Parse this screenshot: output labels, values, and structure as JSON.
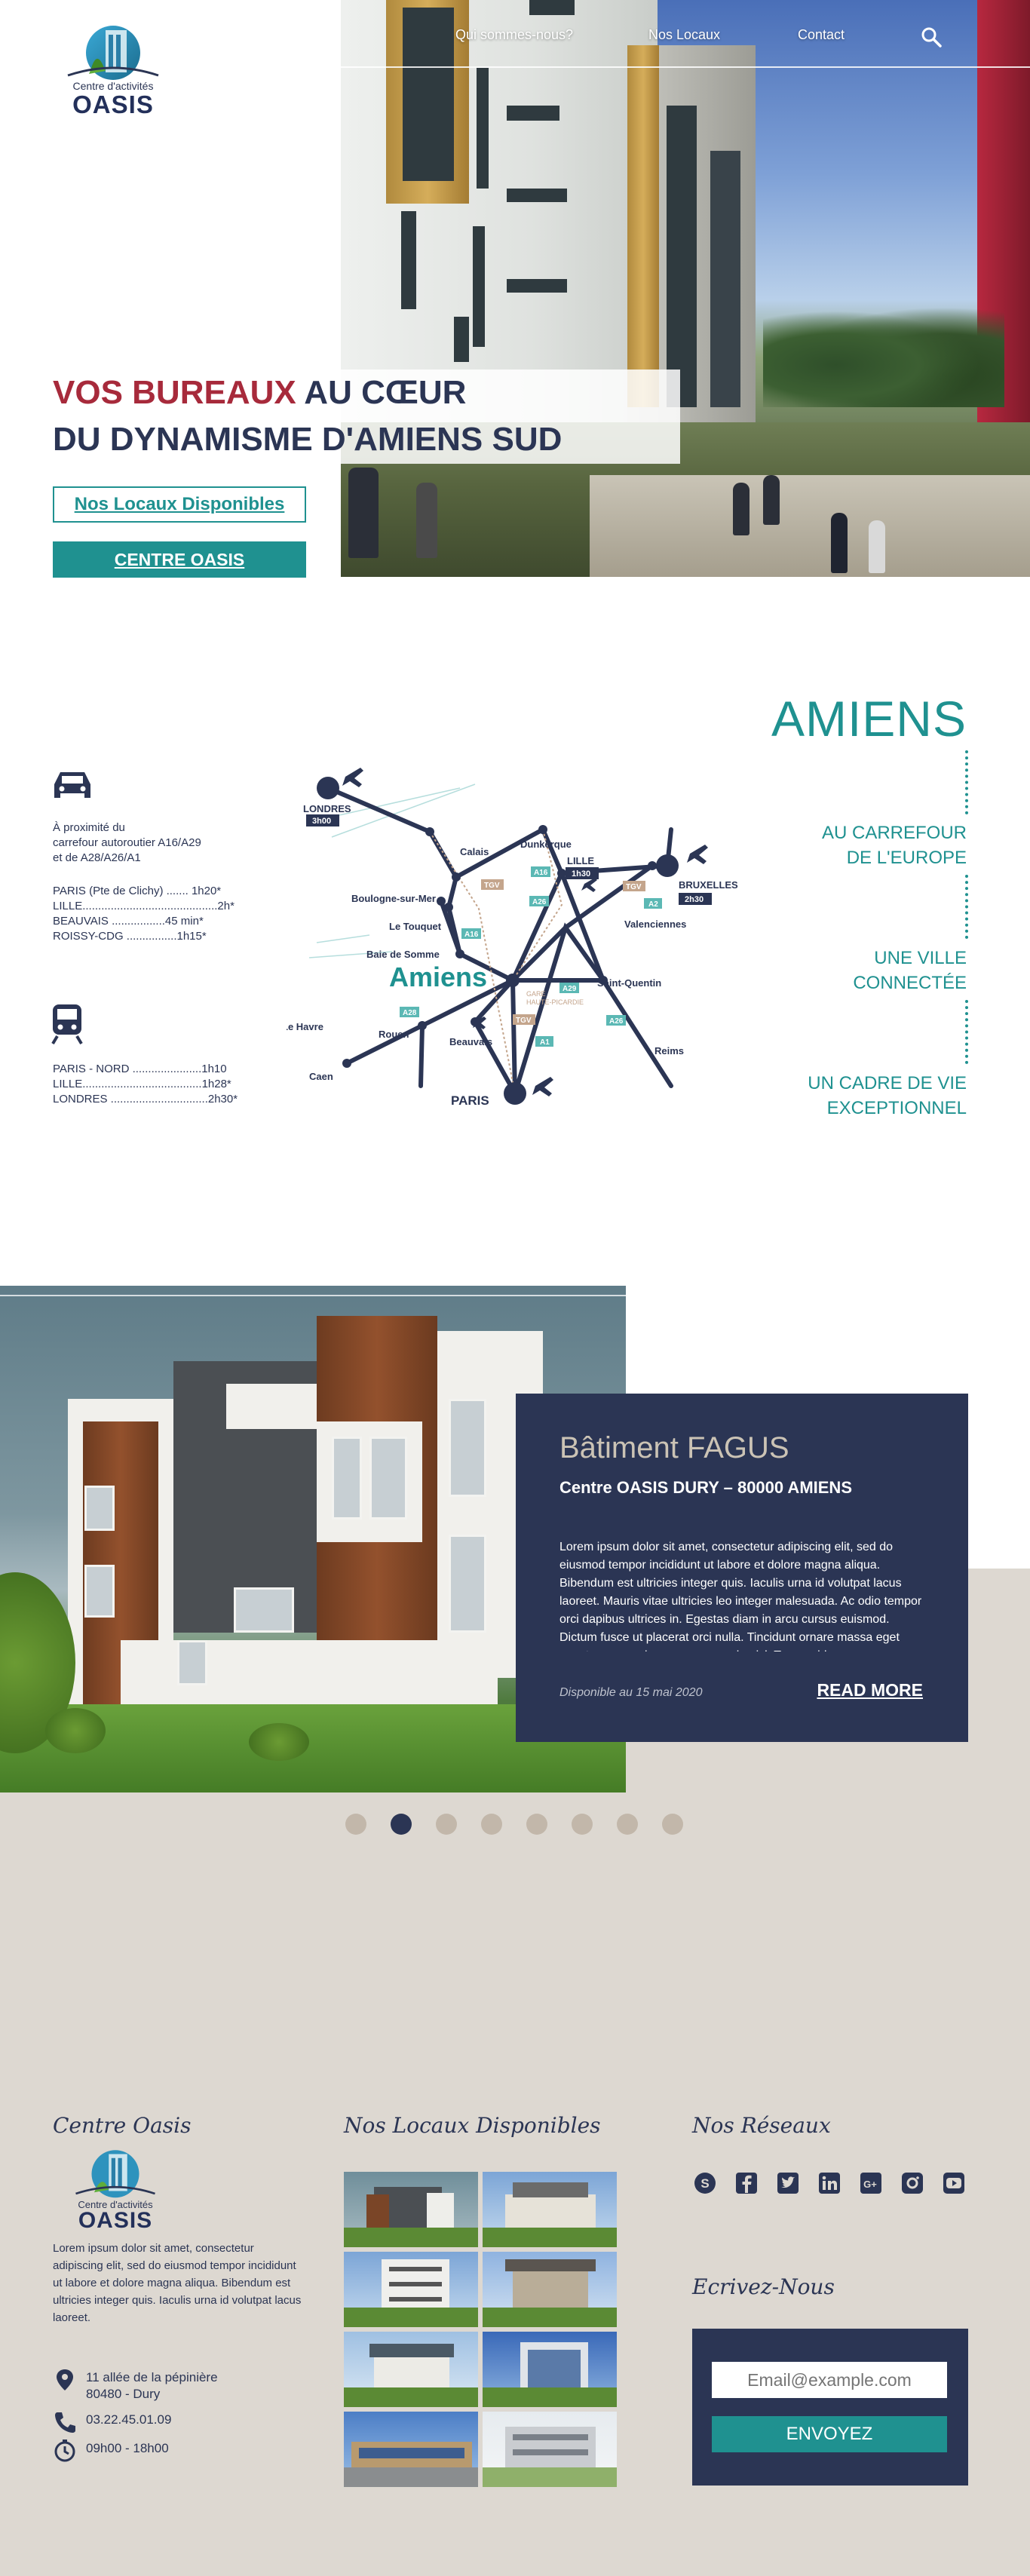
{
  "nav": {
    "items": [
      "Qui sommes-nous?",
      "Nos Locaux",
      "Contact"
    ],
    "search_icon": "search-icon"
  },
  "logo": {
    "small": "Centre d'activités",
    "big": "OASIS"
  },
  "hero": {
    "title_red": "VOS BUREAUX",
    "title_rest_line1": " AU CŒUR",
    "title_line2": "DU DYNAMISME D'AMIENS SUD",
    "btn_locaux": "Nos Locaux Disponibles",
    "btn_centre": "CENTRE OASIS"
  },
  "access": {
    "car_icon": "car-icon",
    "car_intro": [
      "À proximité du",
      "carrefour autoroutier A16/A29",
      "et de A28/A26/A1"
    ],
    "car_times": [
      "PARIS (Pte de Clichy) ....... 1h20*",
      "LILLE...........................................2h*",
      "BEAUVAIS .................45 min*",
      "ROISSY-CDG ................1h15*"
    ],
    "train_icon": "train-icon",
    "train_times": [
      "PARIS - NORD ......................1h10",
      "LILLE......................................1h28*",
      "LONDRES ...............................2h30*"
    ]
  },
  "map": {
    "center": "Amiens",
    "cities": [
      "LONDRES",
      "Calais",
      "Dunkerque",
      "LILLE",
      "BRUXELLES",
      "Boulogne-sur-Mer",
      "Le Touquet",
      "Valenciennes",
      "Baie de Somme",
      "Saint-Quentin",
      "Le Havre",
      "Rouen",
      "Beauvais",
      "Reims",
      "Caen",
      "PARIS"
    ],
    "badges": [
      "3h00",
      "1h30",
      "2h30"
    ],
    "roads": [
      "A16",
      "A26",
      "A2",
      "A16",
      "A28",
      "A29",
      "A1",
      "A26",
      "A29"
    ],
    "tgv": [
      "TGV",
      "TGV",
      "TGV"
    ],
    "gare": [
      "GARE",
      "HAUTE-PICARDIE"
    ]
  },
  "amiens": {
    "title": "AMIENS",
    "tag1": [
      "AU CARREFOUR",
      "DE L'EUROPE"
    ],
    "tag2": [
      "UNE VILLE",
      "CONNECTÉE"
    ],
    "tag3": [
      "UN CADRE DE VIE",
      "EXCEPTIONNEL"
    ]
  },
  "feature": {
    "title": "Bâtiment FAGUS",
    "subtitle": "Centre OASIS DURY – 80000 AMIENS",
    "body": "Lorem ipsum dolor sit amet, consectetur adipiscing elit, sed do eiusmod tempor incididunt ut labore et dolore magna aliqua. Bibendum est ultricies integer quis. Iaculis urna id volutpat lacus laoreet. Mauris vitae ultricies leo integer malesuada. Ac odio tempor orci dapibus ultrices in. Egestas diam in arcu cursus euismod. Dictum fusce ut placerat orci nulla. Tincidunt ornare massa eget egestas purus viverra accumsan in nisl. Tempor id",
    "date": "Disponible au 15 mai 2020",
    "read_more": "READ MORE",
    "slides": 8,
    "active_slide": 2
  },
  "footer": {
    "col1_title": "Centre Oasis",
    "col1_text": "Lorem ipsum dolor sit amet, consectetur adipiscing elit, sed do eiusmod tempor incididunt ut labore et dolore magna aliqua. Bibendum est ultricies integer quis. Iaculis urna id volutpat lacus laoreet.",
    "address": "11 allée de la pépinière\n80480 - Dury",
    "phone": "03.22.45.01.09",
    "hours": "09h00 - 18h00",
    "col2_title": "Nos Locaux Disponibles",
    "col3_title": "Nos Réseaux",
    "social_icons": [
      "skype-icon",
      "facebook-icon",
      "twitter-icon",
      "linkedin-icon",
      "google-plus-icon",
      "instagram-icon",
      "youtube-icon"
    ],
    "form_title": "Ecrivez-Nous",
    "email_placeholder": "Email@example.com",
    "send_label": "ENVOYEZ"
  },
  "colors": {
    "teal": "#1f9190",
    "navy": "#2b3554",
    "red": "#a72a3b",
    "beige": "#ddd8d1"
  }
}
